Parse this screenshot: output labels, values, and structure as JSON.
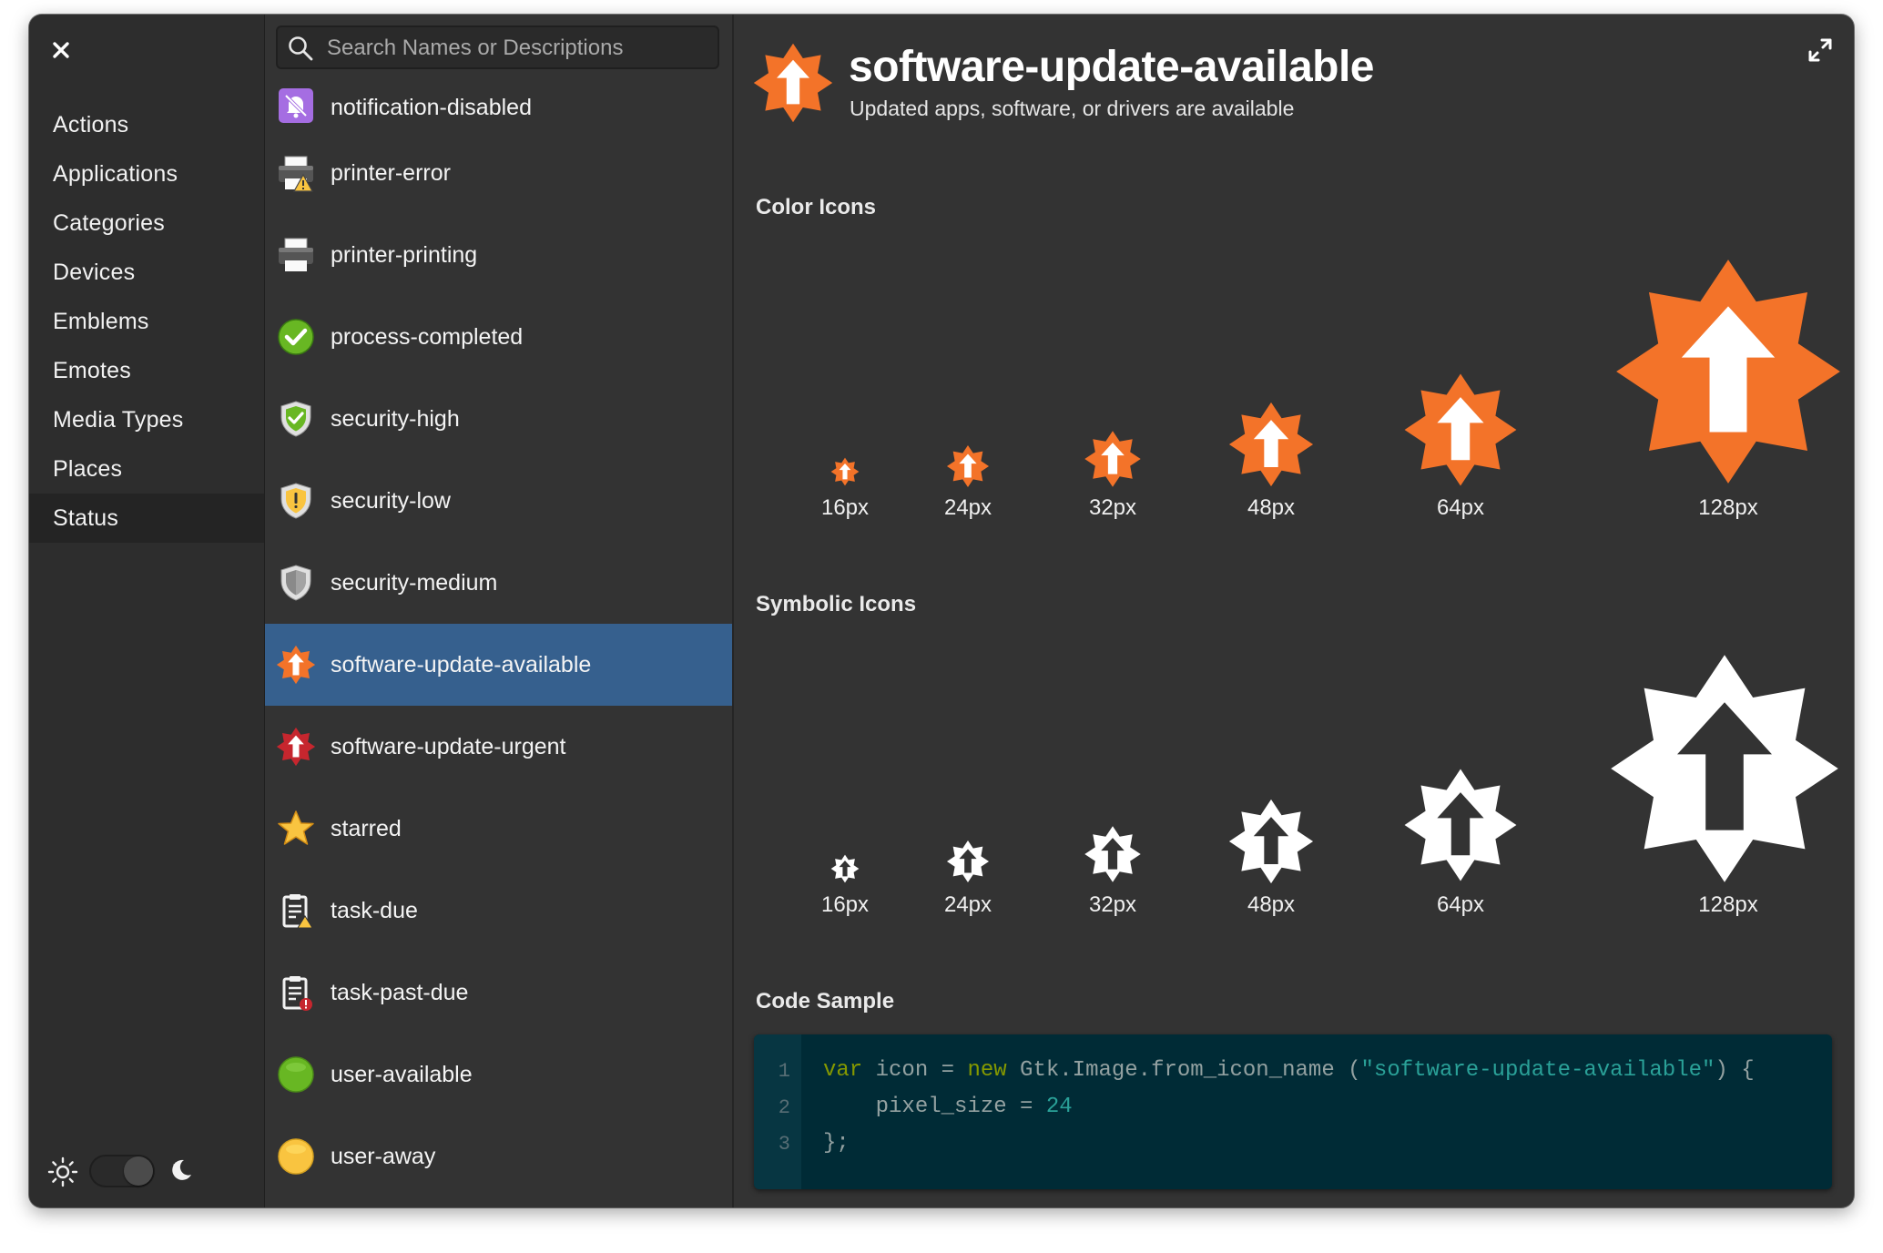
{
  "sidebar": {
    "categories": [
      {
        "label": "Actions"
      },
      {
        "label": "Applications"
      },
      {
        "label": "Categories"
      },
      {
        "label": "Devices"
      },
      {
        "label": "Emblems"
      },
      {
        "label": "Emotes"
      },
      {
        "label": "Media Types"
      },
      {
        "label": "Places"
      },
      {
        "label": "Status",
        "active": true
      }
    ],
    "theme": {
      "light_icon": "sun-icon",
      "dark_icon": "moon-icon",
      "dark_mode": true
    }
  },
  "search": {
    "placeholder": "Search Names or Descriptions",
    "value": ""
  },
  "icon_list": [
    {
      "name": "notification-disabled",
      "icon": "notification-disabled-icon"
    },
    {
      "name": "printer-error",
      "icon": "printer-error-icon"
    },
    {
      "name": "printer-printing",
      "icon": "printer-printing-icon"
    },
    {
      "name": "process-completed",
      "icon": "process-completed-icon"
    },
    {
      "name": "security-high",
      "icon": "security-high-icon"
    },
    {
      "name": "security-low",
      "icon": "security-low-icon"
    },
    {
      "name": "security-medium",
      "icon": "security-medium-icon"
    },
    {
      "name": "software-update-available",
      "icon": "software-update-available-icon",
      "selected": true
    },
    {
      "name": "software-update-urgent",
      "icon": "software-update-urgent-icon"
    },
    {
      "name": "starred",
      "icon": "starred-icon"
    },
    {
      "name": "task-due",
      "icon": "task-due-icon"
    },
    {
      "name": "task-past-due",
      "icon": "task-past-due-icon"
    },
    {
      "name": "user-available",
      "icon": "user-available-icon"
    },
    {
      "name": "user-away",
      "icon": "user-away-icon"
    }
  ],
  "detail": {
    "title": "software-update-available",
    "description": "Updated apps, software, or drivers are available",
    "color_section": "Color Icons",
    "symbolic_section": "Symbolic Icons",
    "code_section": "Code Sample",
    "sizes": [
      "16px",
      "24px",
      "32px",
      "48px",
      "64px",
      "128px"
    ],
    "code": {
      "line_numbers": [
        "1",
        "2",
        "3"
      ],
      "line1": {
        "kw1": "var",
        "t1": " icon = ",
        "kw2": "new",
        "t2": " Gtk.Image.from_icon_name (",
        "str": "\"software-update-available\"",
        "t3": ") {"
      },
      "line2": {
        "t1": "    pixel_size = ",
        "num": "24"
      },
      "line3": {
        "t1": "};"
      }
    }
  },
  "colors": {
    "selection": "#36608e",
    "update_orange": "#f37329",
    "code_bg": "#002b36",
    "keyword": "#859900",
    "string": "#2aa198"
  }
}
